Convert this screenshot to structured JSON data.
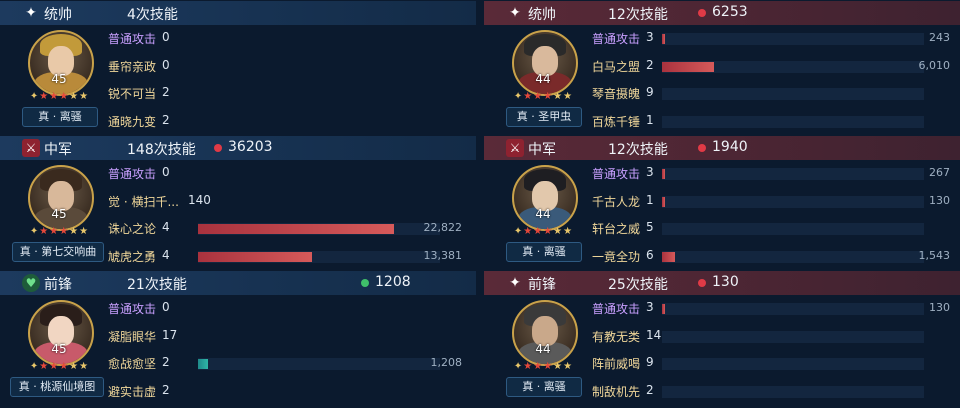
{
  "left": [
    {
      "role": "统帅",
      "badge": "star",
      "count": "4次技能",
      "total": "",
      "general": {
        "level": "45",
        "stars_on": 3,
        "stars_total": 5,
        "tag": "真 · 离骚"
      },
      "skills": [
        {
          "name": "普通攻击",
          "count": "0",
          "value": "",
          "ratio": 0,
          "basic": true
        },
        {
          "name": "垂帘亲政",
          "count": "0",
          "value": "",
          "ratio": 0
        },
        {
          "name": "锐不可当",
          "count": "2",
          "value": "",
          "ratio": 0
        },
        {
          "name": "通晓九变",
          "count": "2",
          "value": "",
          "ratio": 0
        }
      ]
    },
    {
      "role": "中军",
      "badge": "sword",
      "count": "148次技能",
      "total": "36203",
      "dot": "red",
      "general": {
        "level": "45",
        "stars_on": 3,
        "stars_total": 5,
        "tag": "真 · 第七交响曲"
      },
      "skills": [
        {
          "name": "普通攻击",
          "count": "0",
          "value": "",
          "ratio": 0,
          "basic": true
        },
        {
          "name": "觉 · 横扫千...",
          "count": "140",
          "value": "",
          "ratio": 0
        },
        {
          "name": "诛心之论",
          "count": "4",
          "value": "22,822",
          "ratio": 0.81
        },
        {
          "name": "虓虎之勇",
          "count": "4",
          "value": "13,381",
          "ratio": 0.47
        }
      ]
    },
    {
      "role": "前锋",
      "badge": "heart",
      "count": "21次技能",
      "total": "1208",
      "dot": "green",
      "general": {
        "level": "45",
        "stars_on": 3,
        "stars_total": 5,
        "tag": "真 · 桃源仙境图"
      },
      "skills": [
        {
          "name": "普通攻击",
          "count": "0",
          "value": "",
          "ratio": 0,
          "basic": true
        },
        {
          "name": "凝脂眼华",
          "count": "17",
          "value": "",
          "ratio": 0
        },
        {
          "name": "愈战愈坚",
          "count": "2",
          "value": "1,208",
          "ratio": 0.04,
          "teal": true
        },
        {
          "name": "避实击虚",
          "count": "2",
          "value": "",
          "ratio": 0
        }
      ]
    }
  ],
  "right": [
    {
      "role": "统帅",
      "badge": "star",
      "count": "12次技能",
      "total": "6253",
      "dot": "red",
      "general": {
        "level": "44",
        "stars_on": 3,
        "stars_total": 5,
        "tag": "真 · 圣甲虫"
      },
      "skills": [
        {
          "name": "普通攻击",
          "count": "3",
          "value": "243",
          "ratio": 0.01,
          "basic": true
        },
        {
          "name": "白马之盟",
          "count": "2",
          "value": "6,010",
          "ratio": 0.2
        },
        {
          "name": "琴音摄魄",
          "count": "9",
          "value": "",
          "ratio": 0
        },
        {
          "name": "百炼千锤",
          "count": "1",
          "value": "",
          "ratio": 0
        }
      ]
    },
    {
      "role": "中军",
      "badge": "sword",
      "count": "12次技能",
      "total": "1940",
      "dot": "red",
      "general": {
        "level": "44",
        "stars_on": 3,
        "stars_total": 5,
        "tag": "真 · 离骚"
      },
      "skills": [
        {
          "name": "普通攻击",
          "count": "3",
          "value": "267",
          "ratio": 0.01,
          "basic": true
        },
        {
          "name": "千古人龙",
          "count": "1",
          "value": "130",
          "ratio": 0.005
        },
        {
          "name": "轩台之威",
          "count": "5",
          "value": "",
          "ratio": 0
        },
        {
          "name": "一竟全功",
          "count": "6",
          "value": "1,543",
          "ratio": 0.05
        }
      ]
    },
    {
      "role": "前锋",
      "badge": "star",
      "count": "25次技能",
      "total": "130",
      "dot": "red",
      "general": {
        "level": "44",
        "stars_on": 3,
        "stars_total": 5,
        "tag": "真 · 离骚"
      },
      "skills": [
        {
          "name": "普通攻击",
          "count": "3",
          "value": "130",
          "ratio": 0.005,
          "basic": true
        },
        {
          "name": "有教无类",
          "count": "14",
          "value": "",
          "ratio": 0
        },
        {
          "name": "阵前威喝",
          "count": "9",
          "value": "",
          "ratio": 0
        },
        {
          "name": "制敌机先",
          "count": "2",
          "value": "",
          "ratio": 0
        }
      ]
    }
  ],
  "colors": {
    "bar": "#c8444c",
    "teal_bar": "#25a39a",
    "basic_skill": "#c9a0ff",
    "skill": "#f0d79a"
  }
}
